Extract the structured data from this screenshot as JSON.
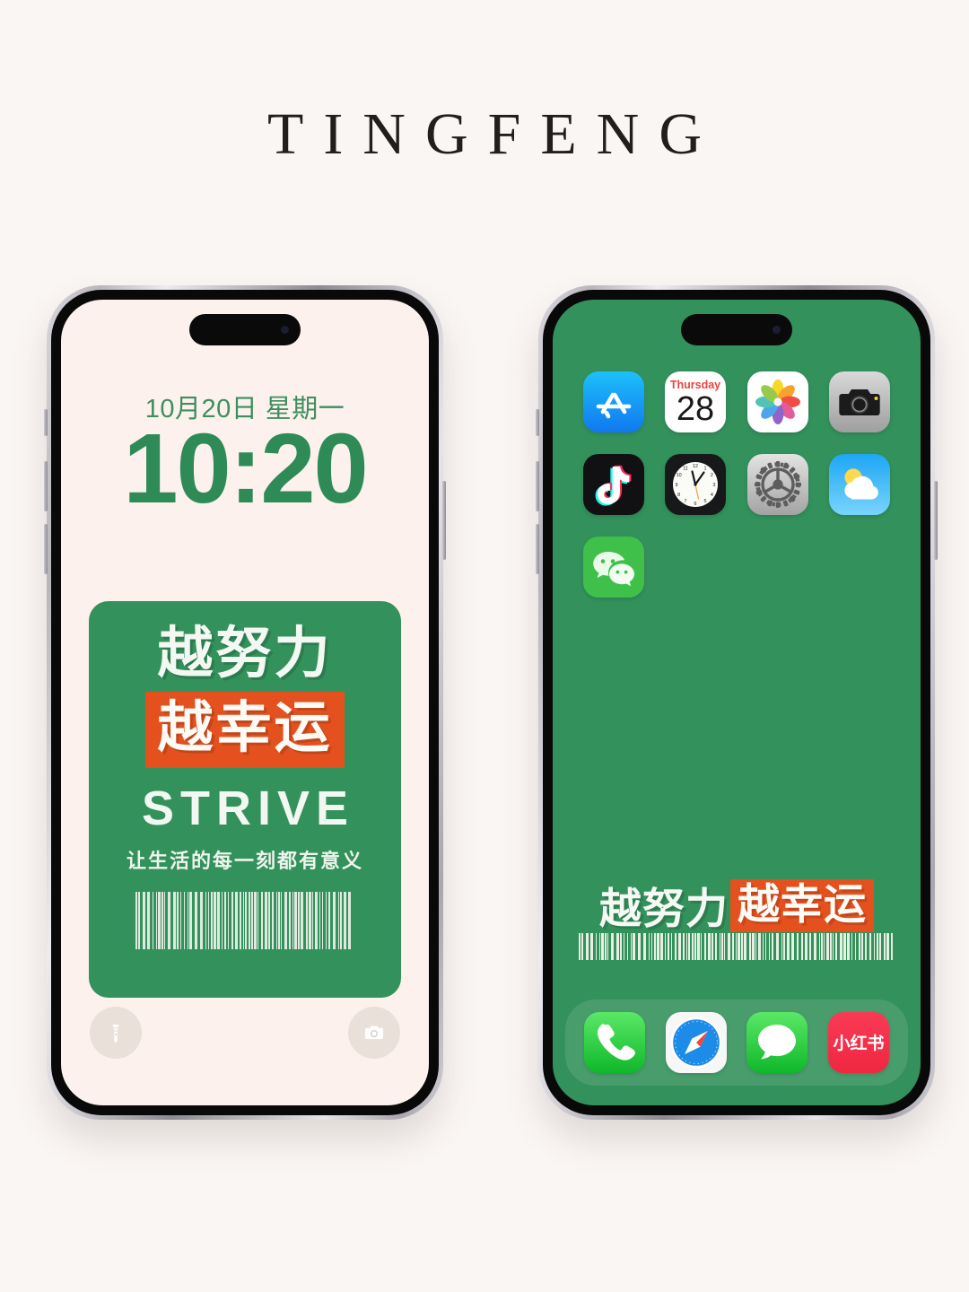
{
  "brand": {
    "title": "TINGFENG"
  },
  "colors": {
    "page_bg": "#faf6f4",
    "green": "#33915c",
    "orange": "#e5511e",
    "cream": "#fcf1ec",
    "time_green": "#2e8b57"
  },
  "lock_screen": {
    "date": "10月20日 星期一",
    "time": "10:20",
    "card": {
      "line1": "越努力",
      "line2": "越幸运",
      "line3": "STRIVE",
      "line4": "让生活的每一刻都有意义",
      "barcode": "barcode-icon"
    },
    "bottom_buttons": [
      {
        "name": "flashlight-button",
        "icon": "flashlight-icon"
      },
      {
        "name": "camera-button",
        "icon": "camera-icon"
      }
    ]
  },
  "home_screen": {
    "apps": [
      {
        "name": "app-store",
        "label": "App Store",
        "icon": "app-store-icon"
      },
      {
        "name": "calendar",
        "label": "Calendar",
        "icon": "calendar-icon",
        "weekday": "Thursday",
        "day": "28"
      },
      {
        "name": "photos",
        "label": "Photos",
        "icon": "photos-icon"
      },
      {
        "name": "camera",
        "label": "Camera",
        "icon": "camera-icon"
      },
      {
        "name": "tiktok",
        "label": "TikTok",
        "icon": "tiktok-icon"
      },
      {
        "name": "clock",
        "label": "Clock",
        "icon": "clock-icon"
      },
      {
        "name": "settings",
        "label": "Settings",
        "icon": "settings-gear-icon"
      },
      {
        "name": "weather",
        "label": "Weather",
        "icon": "weather-icon"
      },
      {
        "name": "wechat",
        "label": "WeChat",
        "icon": "wechat-icon"
      }
    ],
    "slogan": {
      "white": "越努力",
      "orange": "越幸运",
      "barcode": "barcode-icon"
    },
    "dock": [
      {
        "name": "phone",
        "label": "Phone",
        "icon": "phone-icon"
      },
      {
        "name": "safari",
        "label": "Safari",
        "icon": "safari-compass-icon"
      },
      {
        "name": "messages",
        "label": "Messages",
        "icon": "messages-bubble-icon"
      },
      {
        "name": "xiaohongshu",
        "label": "小红书",
        "icon": "xiaohongshu-icon"
      }
    ]
  }
}
